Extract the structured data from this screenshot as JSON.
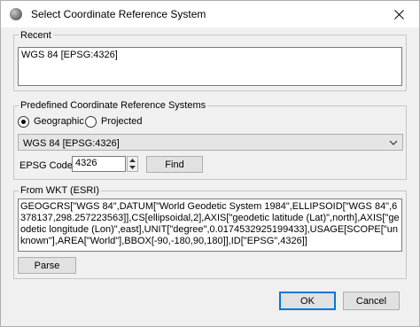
{
  "window": {
    "title": "Select Coordinate Reference System",
    "icon": "globe-icon",
    "close_icon": "close-icon"
  },
  "recent": {
    "group_label": "Recent",
    "value": "WGS 84 [EPSG:4326]"
  },
  "predefined": {
    "group_label": "Predefined Coordinate Reference Systems",
    "radio_geographic": "Geographic",
    "radio_projected": "Projected",
    "selected_radio": "Geographic",
    "combo_value": "WGS 84 [EPSG:4326]",
    "epsg_label": "EPSG Code",
    "epsg_value": "4326",
    "find_label": "Find"
  },
  "wkt": {
    "group_label": "From WKT (ESRI)",
    "text": "GEOGCRS[\"WGS 84\",DATUM[\"World Geodetic System 1984\",ELLIPSOID[\"WGS 84\",6378137,298.257223563]],CS[ellipsoidal,2],AXIS[\"geodetic latitude (Lat)\",north],AXIS[\"geodetic longitude (Lon)\",east],UNIT[\"degree\",0.0174532925199433],USAGE[SCOPE[\"unknown\"],AREA[\"World\"],BBOX[-90,-180,90,180]],ID[\"EPSG\",4326]]",
    "parse_label": "Parse"
  },
  "footer": {
    "ok_label": "OK",
    "cancel_label": "Cancel"
  },
  "colors": {
    "dialog_bg": "#f0f0f0",
    "default_button_border": "#0078d7"
  }
}
